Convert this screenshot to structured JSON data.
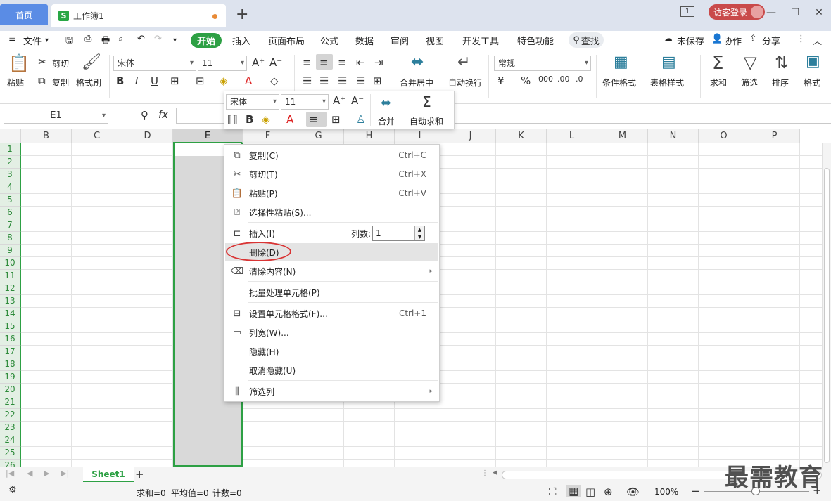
{
  "tabs": {
    "home": "首页",
    "doc": "工作簿1",
    "doc_icon": "S",
    "add": "+"
  },
  "titlebar": {
    "book_icon": "1",
    "login": "访客登录",
    "min": "—",
    "restore": "☐",
    "close": "✕",
    "menu": "≡"
  },
  "menu": {
    "file": "文件",
    "start": "开始",
    "insert": "插入",
    "layout": "页面布局",
    "formula": "公式",
    "data": "数据",
    "review": "审阅",
    "view": "视图",
    "dev": "开发工具",
    "special": "特色功能",
    "search": "查找",
    "unsaved": "未保存",
    "collab": "协作",
    "share": "分享"
  },
  "ribbon": {
    "paste": "粘贴",
    "cut": "剪切",
    "copy": "复制",
    "format_painter": "格式刷",
    "font_name": "宋体",
    "font_size": "11",
    "merge_center": "合并居中",
    "wrap_text": "自动换行",
    "number_format": "常规",
    "cond_format": "条件格式",
    "table_style": "表格样式",
    "sum": "求和",
    "filter": "筛选",
    "sort": "排序",
    "format": "格式"
  },
  "formula_bar": {
    "name_box": "E1",
    "fx": "fx"
  },
  "grid": {
    "columns": [
      "B",
      "C",
      "D",
      "E",
      "F",
      "G",
      "H",
      "I",
      "J",
      "K",
      "L",
      "M",
      "N",
      "O",
      "P"
    ],
    "rows": [
      "1",
      "2",
      "3",
      "4",
      "5",
      "6",
      "7",
      "8",
      "9",
      "10",
      "11",
      "12",
      "13",
      "14",
      "15",
      "16",
      "17",
      "18",
      "19",
      "20",
      "21",
      "22",
      "23",
      "24",
      "25",
      "26"
    ],
    "selected_column": "E"
  },
  "mini_toolbar": {
    "font_name": "宋体",
    "font_size": "11",
    "merge": "合并",
    "autosum": "自动求和"
  },
  "context_menu": {
    "copy": "复制(C)",
    "copy_sc": "Ctrl+C",
    "cut": "剪切(T)",
    "cut_sc": "Ctrl+X",
    "paste": "粘贴(P)",
    "paste_sc": "Ctrl+V",
    "paste_special": "选择性粘贴(S)...",
    "insert": "插入(I)",
    "col_count_label": "列数:",
    "col_count": "1",
    "delete": "删除(D)",
    "clear": "清除内容(N)",
    "batch": "批量处理单元格(P)",
    "format_cells": "设置单元格格式(F)...",
    "format_cells_sc": "Ctrl+1",
    "col_width": "列宽(W)...",
    "hide": "隐藏(H)",
    "unhide": "取消隐藏(U)",
    "filter_col": "筛选列"
  },
  "sheets": {
    "active": "Sheet1",
    "add": "+"
  },
  "status": {
    "sum": "求和=0",
    "avg": "平均值=0",
    "count": "计数=0",
    "zoom": "100%"
  },
  "watermark": "最需教育",
  "colors": {
    "accent_green": "#2da044",
    "tab_blue": "#5a8ce5",
    "login_red": "#c94a4a",
    "ring_red": "#d93434"
  }
}
